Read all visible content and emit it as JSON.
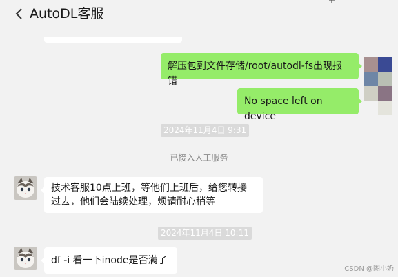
{
  "header": {
    "title": "AutoDL客服"
  },
  "messages": {
    "user_1": "解压包到文件存储/root/autodl-fs出现报错",
    "user_2": "No space left on device",
    "time_1": "2024年11月4日 9:31",
    "system_1": "已接入人工服务",
    "agent_1": "技术客服10点上班，等他们上班后，给您转接过去，他们会陆续处理，烦请耐心稍等",
    "time_2": "2024年11月4日 10:11",
    "agent_2": "df -i  看一下inode是否满了"
  },
  "watermark": "CSDN @图小奶",
  "colors": {
    "user_bubble": "#95ec69",
    "agent_bubble": "#ffffff",
    "background": "#f2f2f2"
  },
  "icons": {
    "back": "chevron-left-icon",
    "pin": "pin-icon",
    "minimize": "minimize-icon",
    "maximize": "maximize-icon"
  }
}
